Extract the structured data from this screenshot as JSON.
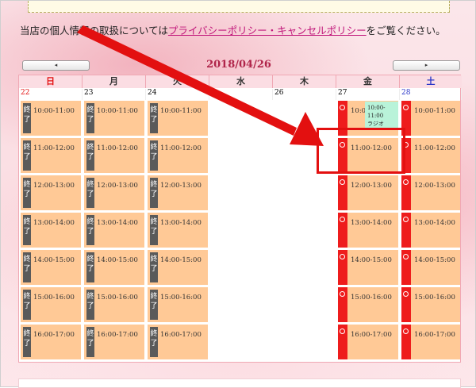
{
  "notice": {
    "before": "当店の個人情報の取扱については",
    "link": "プライバシーポリシー・キャンセルポリシー",
    "after": "をご覧ください。"
  },
  "calendar": {
    "title": "2018/04/26",
    "prev_label": "◂",
    "next_label": "▸",
    "weekdays": [
      "日",
      "月",
      "火",
      "水",
      "木",
      "金",
      "土"
    ],
    "dates": [
      "22",
      "23",
      "24",
      "",
      "26",
      "27",
      "28"
    ],
    "done_label": "終了",
    "times": [
      "10:00-11:00",
      "11:00-12:00",
      "12:00-13:00",
      "13:00-14:00",
      "14:00-15:00",
      "15:00-16:00",
      "16:00-17:00"
    ],
    "reserved": {
      "time": "10:00-11:00",
      "label": "ラジオ"
    },
    "friday_first_time": "10:00-"
  },
  "colors": {
    "accent_pink": "#c0157a",
    "slot_orange": "#ffc996",
    "available_red": "#ee1c1c",
    "reserved_green": "#b9f3d9",
    "title_color": "#b0254a"
  }
}
